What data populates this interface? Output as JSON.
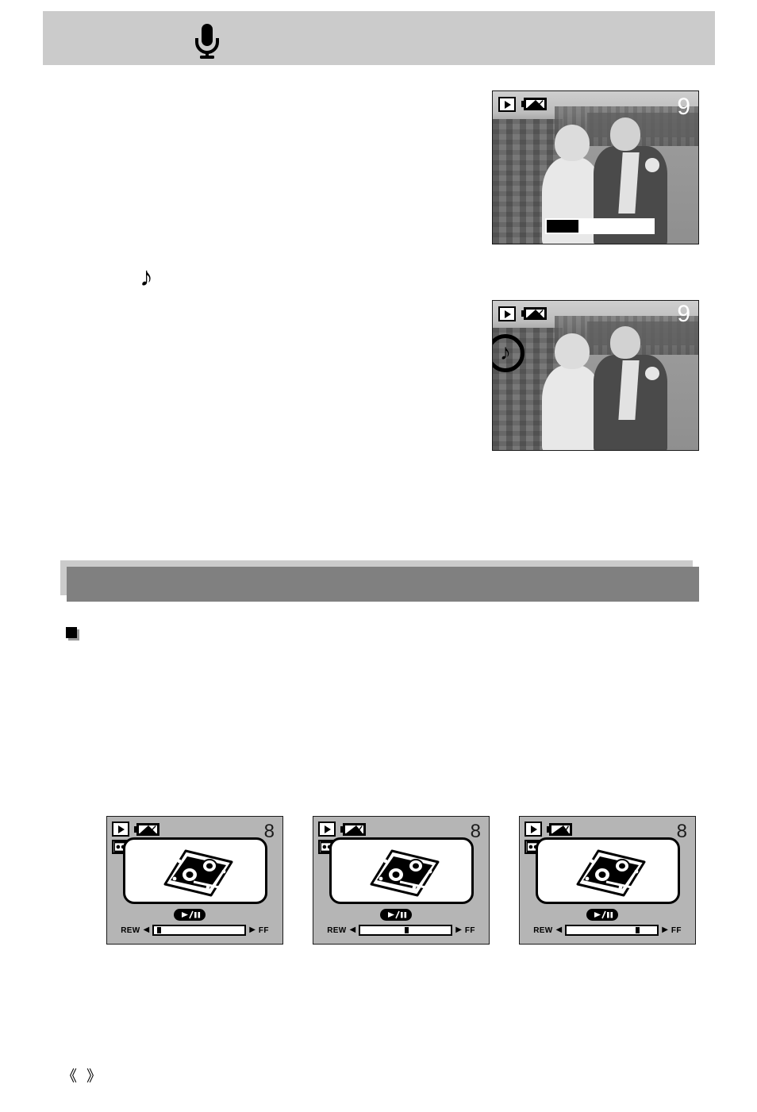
{
  "document": {
    "footer": {
      "bracket_open": "《",
      "bracket_close": "》",
      "title": "",
      "page_number": ""
    }
  },
  "sections": [
    {
      "id": "voice-memo",
      "title": "",
      "icon": "microphone-icon",
      "body": [
        "",
        ""
      ],
      "inline_glyph": "♪"
    },
    {
      "id": "voice-playback",
      "title": "",
      "icon": "play-pause-icon",
      "body": [
        "",
        ""
      ],
      "bullet": "square-bullet"
    }
  ],
  "lcd_photo_screens": [
    {
      "name": "recording-voice-memo",
      "playback_icon": "playback-mode-icon",
      "battery_icon": "battery-icon",
      "counter": "9",
      "recording_bar": {
        "visible": true,
        "fill_percent": 30
      },
      "music_badge": null
    },
    {
      "name": "voice-memo-attached",
      "playback_icon": "playback-mode-icon",
      "battery_icon": "battery-icon",
      "counter": "9",
      "recording_bar": null,
      "music_badge": "music-note-icon"
    }
  ],
  "lcd_voice_screens": [
    {
      "name": "voice-playback-start",
      "playback_icon": "playback-mode-icon",
      "voicememo_icon": "voice-memo-icon",
      "battery_icon": "battery-icon",
      "counter": "8",
      "tape_icon": "cassette-tape-icon",
      "playpause_badge": "play-pause-icon",
      "rew_label": "REW",
      "ff_label": "FF",
      "rew_arrow": "◀",
      "ff_arrow": "▶",
      "marker_percent": 3
    },
    {
      "name": "voice-playback-middle",
      "playback_icon": "playback-mode-icon",
      "voicememo_icon": "voice-memo-icon",
      "battery_icon": "battery-icon",
      "counter": "8",
      "tape_icon": "cassette-tape-icon",
      "playpause_badge": "play-pause-icon",
      "rew_label": "REW",
      "ff_label": "FF",
      "rew_arrow": "◀",
      "ff_arrow": "▶",
      "marker_percent": 49
    },
    {
      "name": "voice-playback-later",
      "playback_icon": "playback-mode-icon",
      "voicememo_icon": "voice-memo-icon",
      "battery_icon": "battery-icon",
      "counter": "8",
      "tape_icon": "cassette-tape-icon",
      "playpause_badge": "play-pause-icon",
      "rew_label": "REW",
      "ff_label": "FF",
      "rew_arrow": "◀",
      "ff_arrow": "▶",
      "marker_percent": 76
    }
  ],
  "colors": {
    "section_bar": "#cbcbcb",
    "section_shadow": "#808080",
    "lcd_background": "#b5b5b5",
    "ink": "#000000",
    "panel": "#ffffff"
  }
}
